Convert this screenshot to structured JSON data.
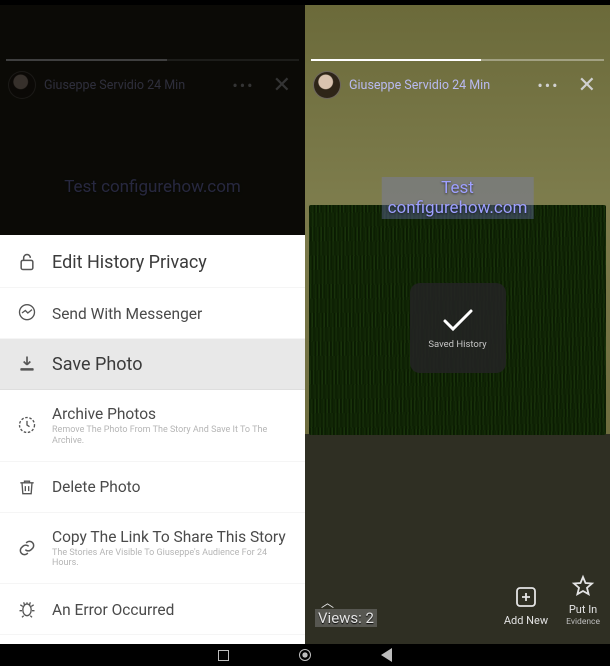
{
  "left": {
    "username": "Giuseppe Servidio 24 Min",
    "watermark": "Test configurehow.com",
    "sheet": {
      "edit_privacy": "Edit History Privacy",
      "send_messenger": "Send With Messenger",
      "save_photo": "Save Photo",
      "archive_title": "Archive Photos",
      "archive_sub": "Remove The Photo From The Story And Save It To The Archive.",
      "delete_photo": "Delete Photo",
      "copy_link_title": "Copy The Link To Share This Story",
      "copy_link_sub": "The Stories Are Visible To Giuseppe's Audience For 24 Hours.",
      "error": "An Error Occurred"
    }
  },
  "right": {
    "username": "Giuseppe Servidio 24 Min",
    "watermark": "Test configurehow.com",
    "toast": "Saved History",
    "views_label": "Views: 2",
    "add_new": "Add New",
    "put_in": "Put In",
    "put_in_sub": "Evidence"
  }
}
